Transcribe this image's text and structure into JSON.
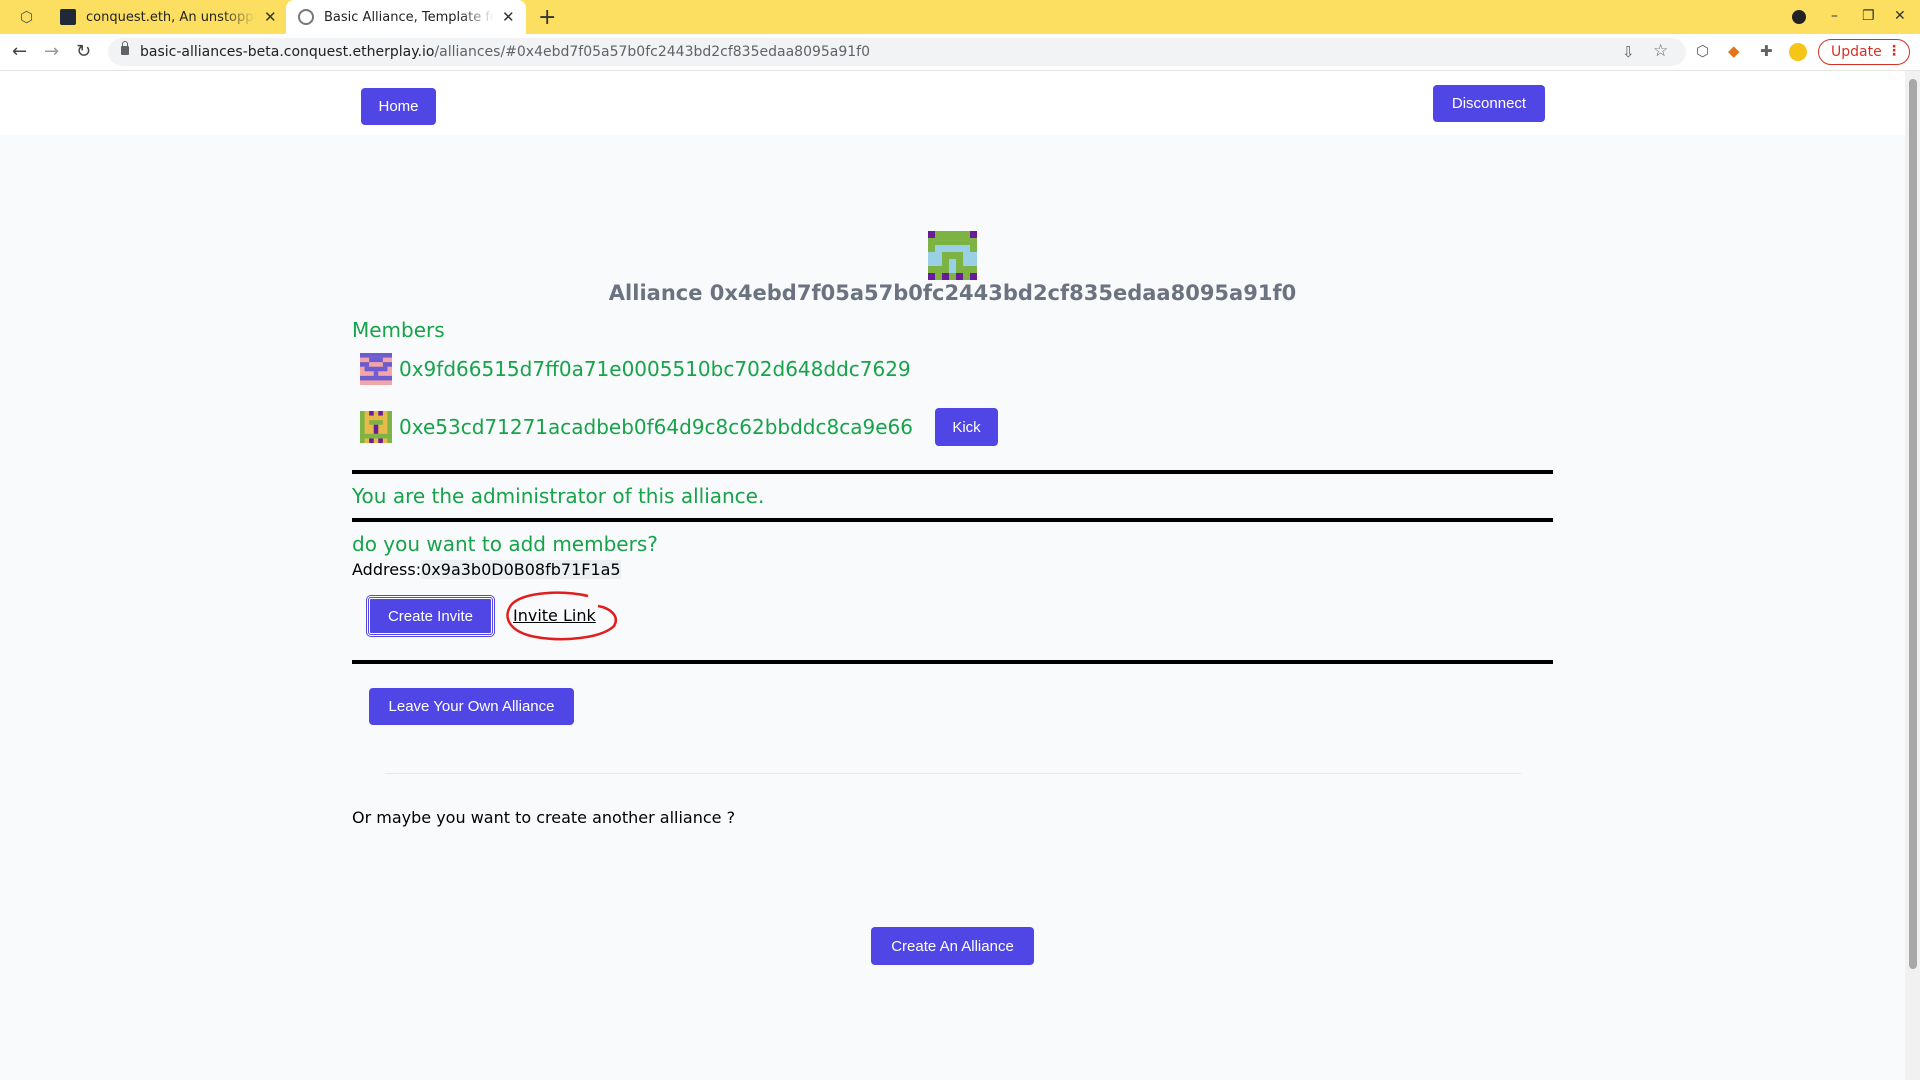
{
  "browser": {
    "tabs": [
      {
        "title": "conquest.eth, An unstoppable",
        "active": false
      },
      {
        "title": "Basic Alliance, Template for",
        "active": true
      }
    ],
    "new_tab": "+",
    "close": "✕",
    "url_host": "basic-alliances-beta.conquest.etherplay.io",
    "url_path": "/alliances/#0x4ebd7f05a57b0fc2443bd2cf835edaa8095a91f0",
    "update_label": "Update"
  },
  "header": {
    "home_label": "Home",
    "disconnect_label": "Disconnect"
  },
  "alliance": {
    "title": "Alliance 0x4ebd7f05a57b0fc2443bd2cf835edaa8095a91f0",
    "members_heading": "Members",
    "members": [
      {
        "address": "0x9fd66515d7ff0a71e0005510bc702d648ddc7629"
      },
      {
        "address": "0xe53cd71271acadbeb0f64d9c8c62bbddc8ca9e66",
        "action": "Kick"
      }
    ],
    "admin_text": "You are the administrator of this alliance.",
    "add_members_text": "do you want to add members?",
    "address_label": "Address:",
    "address_value": "0x9a3b0D0B08fb71F1a5",
    "create_invite_label": "Create Invite",
    "invite_link_label": "Invite Link",
    "leave_label": "Leave Your Own Alliance",
    "other_text": "Or maybe you want to create another alliance ?",
    "create_alliance_label": "Create An Alliance"
  },
  "colors": {
    "accent": "#4f46e5",
    "member_text": "#16a34a",
    "annotation": "#e11d1d",
    "tabbar": "#fcdf61"
  }
}
